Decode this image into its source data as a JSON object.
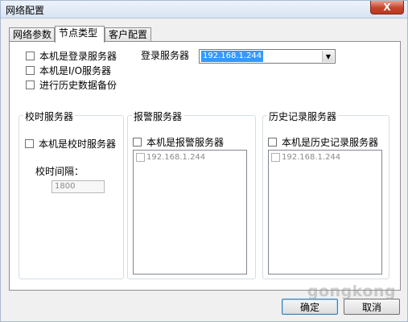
{
  "window": {
    "title": "网络配置",
    "close_label": "X"
  },
  "tabs": [
    {
      "label": "网络参数"
    },
    {
      "label": "节点类型"
    },
    {
      "label": "客户配置"
    }
  ],
  "node_type": {
    "checkboxes": [
      {
        "label": "本机是登录服务器"
      },
      {
        "label": "本机是I/O服务器"
      },
      {
        "label": "进行历史数据备份"
      }
    ],
    "login_server_label": "登录服务器",
    "login_server_value": "192.168.1.244"
  },
  "time_server": {
    "legend": "校时服务器",
    "checkbox_label": "本机是校时服务器",
    "interval_label": "校时间隔：",
    "interval_value": "1800"
  },
  "alarm_server": {
    "legend": "报警服务器",
    "checkbox_label": "本机是报警服务器",
    "items": [
      "192.168.1.244"
    ]
  },
  "history_server": {
    "legend": "历史记录服务器",
    "checkbox_label": "本机是历史记录服务器",
    "items": [
      "192.168.1.244"
    ]
  },
  "buttons": {
    "ok": "确定",
    "cancel": "取消"
  },
  "watermark": "gongkong"
}
